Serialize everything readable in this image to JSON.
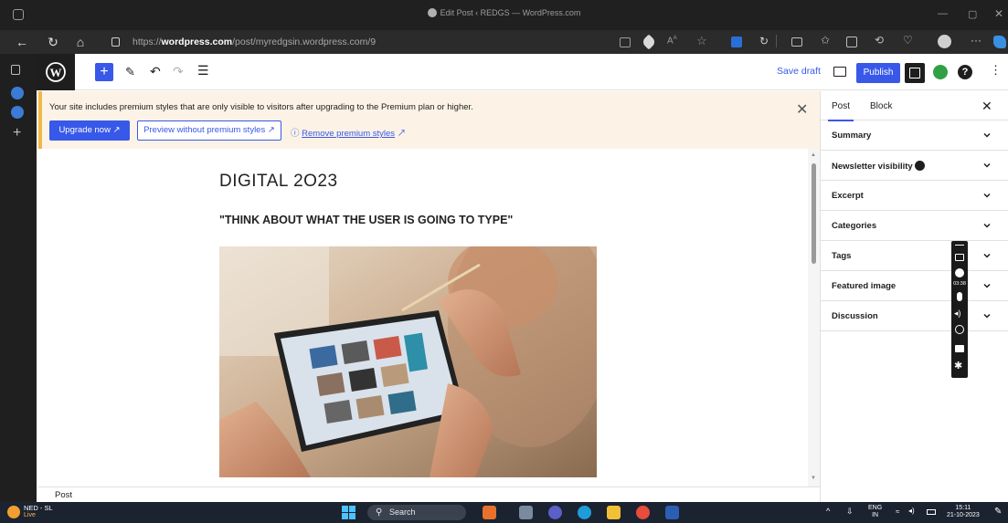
{
  "browser": {
    "tab_title": "Edit Post ‹ REDGS — WordPress.com",
    "url_prefix": "https://",
    "url_domain": "wordpress.com",
    "url_path": "/post/myredgsin.wordpress.com/9"
  },
  "toolbar": {
    "save_draft": "Save draft",
    "publish": "Publish"
  },
  "notice": {
    "message": "Your site includes premium styles that are only visible to visitors after upgrading to the Premium plan or higher.",
    "upgrade_label": "Upgrade now",
    "preview_label": "Preview without premium styles",
    "remove_label": "Remove premium styles"
  },
  "post": {
    "title": "DIGITAL 2O23",
    "heading": "\"THINK ABOUT WHAT THE USER IS GOING TO TYPE\""
  },
  "footer": {
    "breadcrumb": "Post"
  },
  "sidebar": {
    "tabs": [
      "Post",
      "Block"
    ],
    "panels": [
      {
        "label": "Summary"
      },
      {
        "label": "Newsletter visibility"
      },
      {
        "label": "Excerpt"
      },
      {
        "label": "Categories"
      },
      {
        "label": "Tags"
      },
      {
        "label": "Featured image"
      },
      {
        "label": "Discussion"
      }
    ]
  },
  "recorder": {
    "time": "03:38"
  },
  "taskbar": {
    "weather_title": "NED - SL",
    "weather_sub": "Live",
    "search_placeholder": "Search",
    "lang_top": "ENG",
    "lang_bottom": "IN",
    "time": "15:11",
    "date": "21-10-2023"
  },
  "colors": {
    "wp_blue": "#3858e9",
    "notice_bg": "#fcf3e6",
    "notice_border": "#f0b849",
    "browser_dark": "#202020",
    "taskbar": "#1b2330"
  }
}
